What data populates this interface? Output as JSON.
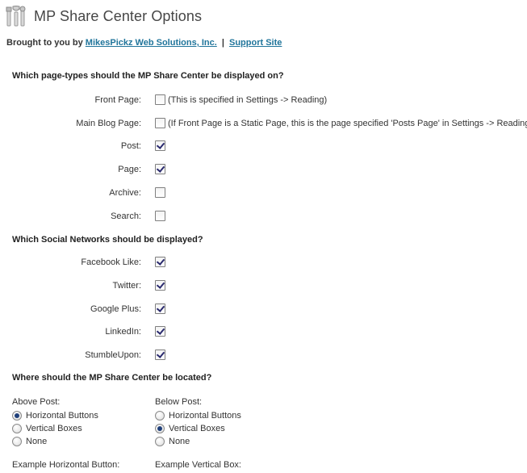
{
  "header": {
    "title": "MP Share Center Options",
    "icon": "tools-icon"
  },
  "credit": {
    "prefix": "Brought to you by",
    "company_link": "MikesPickz Web Solutions, Inc.",
    "separator": "|",
    "support_link": "Support Site",
    "link_color": "#21759b"
  },
  "page_types": {
    "heading": "Which page-types should the MP Share Center be displayed on?",
    "items": [
      {
        "label": "Front Page:",
        "checked": false,
        "note": "(This is specified in Settings -> Reading)"
      },
      {
        "label": "Main Blog Page:",
        "checked": false,
        "note": "(If Front Page is a Static Page, this is the page specified 'Posts Page' in Settings -> Reading)"
      },
      {
        "label": "Post:",
        "checked": true,
        "note": ""
      },
      {
        "label": "Page:",
        "checked": true,
        "note": ""
      },
      {
        "label": "Archive:",
        "checked": false,
        "note": ""
      },
      {
        "label": "Search:",
        "checked": false,
        "note": ""
      }
    ]
  },
  "networks": {
    "heading": "Which Social Networks should be displayed?",
    "items": [
      {
        "label": "Facebook Like:",
        "checked": true
      },
      {
        "label": "Twitter:",
        "checked": true
      },
      {
        "label": "Google Plus:",
        "checked": true
      },
      {
        "label": "LinkedIn:",
        "checked": true
      },
      {
        "label": "StumbleUpon:",
        "checked": true
      }
    ]
  },
  "location": {
    "heading": "Where should the MP Share Center be located?",
    "above": {
      "title": "Above Post:",
      "options": [
        "Horizontal Buttons",
        "Vertical Boxes",
        "None"
      ],
      "selected": 0
    },
    "below": {
      "title": "Below Post:",
      "options": [
        "Horizontal Buttons",
        "Vertical Boxes",
        "None"
      ],
      "selected": 1
    }
  },
  "examples": {
    "horizontal_label": "Example Horizontal Button:",
    "vertical_label": "Example Vertical Box:"
  }
}
